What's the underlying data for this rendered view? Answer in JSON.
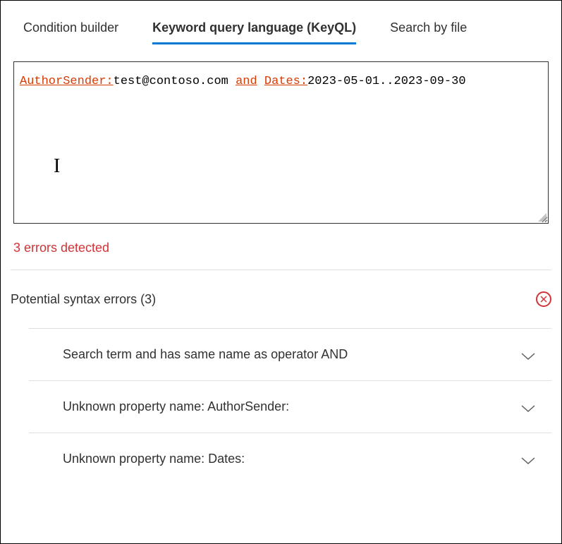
{
  "tabs": [
    {
      "label": "Condition builder",
      "active": false
    },
    {
      "label": "Keyword query language (KeyQL)",
      "active": true
    },
    {
      "label": "Search by file",
      "active": false
    }
  ],
  "query": {
    "tokens": [
      {
        "text": "AuthorSender:",
        "type": "error"
      },
      {
        "text": "test@contoso.com ",
        "type": "text"
      },
      {
        "text": "and",
        "type": "error"
      },
      {
        "text": " ",
        "type": "text"
      },
      {
        "text": "Dates:",
        "type": "error"
      },
      {
        "text": "2023-05-01..2023-09-30",
        "type": "text"
      }
    ]
  },
  "error_summary": "3 errors detected",
  "section": {
    "title": "Potential syntax errors (3)"
  },
  "errors": [
    {
      "message": "Search term and has same name as operator AND"
    },
    {
      "message": "Unknown property name: AuthorSender:"
    },
    {
      "message": "Unknown property name: Dates:"
    }
  ]
}
